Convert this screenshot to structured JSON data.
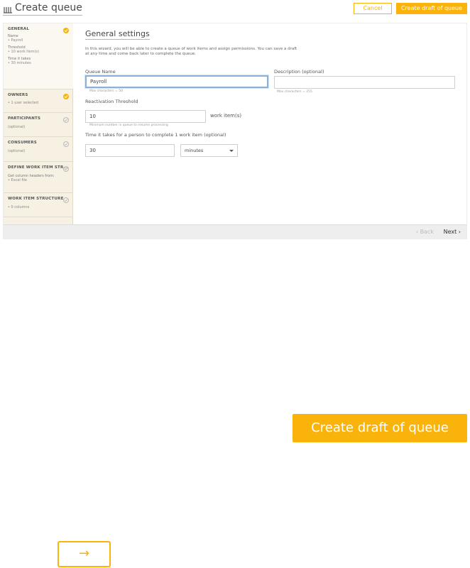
{
  "header": {
    "title": "Create queue",
    "icon": "queue-icon",
    "cancel_label": "Cancel",
    "create_label": "Create draft of queue"
  },
  "sidebar": {
    "steps": [
      {
        "title": "GENERAL",
        "lines": [
          [
            "Name",
            "• Payroll"
          ],
          [
            "Threshold",
            "• 10 work item(s)"
          ],
          [
            "Time it takes",
            "• 30 minutes"
          ]
        ],
        "status": "done"
      },
      {
        "title": "OWNERS",
        "lines": [
          [
            "",
            "• 1 user selected"
          ]
        ],
        "status": "done"
      },
      {
        "title": "PARTICIPANTS",
        "lines": [
          [
            "",
            "(optional)"
          ]
        ],
        "status": "todo"
      },
      {
        "title": "CONSUMERS",
        "lines": [
          [
            "",
            "(optional)"
          ]
        ],
        "status": "todo"
      },
      {
        "title": "DEFINE WORK ITEM STR...",
        "lines": [
          [
            "Get column headers from:",
            "• Excel file"
          ]
        ],
        "status": "todo"
      },
      {
        "title": "WORK ITEM STRUCTURE",
        "lines": [
          [
            "",
            "• 0 columns"
          ]
        ],
        "status": "todo"
      }
    ]
  },
  "main": {
    "section_title": "General settings",
    "intro": "In this wizard, you will be able to create a queue of work items and assign permissions. You can save a draft at any time and come back later to complete the queue.",
    "queue_name_label": "Queue Name",
    "queue_name_value": "Payroll",
    "queue_name_hint": "Max characters = 50",
    "description_label": "Description (optional)",
    "description_value": "",
    "description_hint": "Max characters = 255",
    "threshold_label": "Reactivation Threshold",
    "threshold_value": "10",
    "threshold_unit": "work item(s)",
    "threshold_hint": "Minimum number in queue to resume processing",
    "time_label": "Time it takes for a person to complete 1 work item (optional)",
    "time_value": "30",
    "time_unit_selected": "minutes"
  },
  "footer": {
    "back_label": "‹ Back",
    "next_label": "Next ›"
  },
  "zoom": {
    "create_label": "Create draft of queue",
    "next_arrow": "→"
  },
  "colors": {
    "accent": "#f9b30b",
    "sidebar_bg": "#f7f1e4",
    "focus_border": "#8ab2d8"
  }
}
